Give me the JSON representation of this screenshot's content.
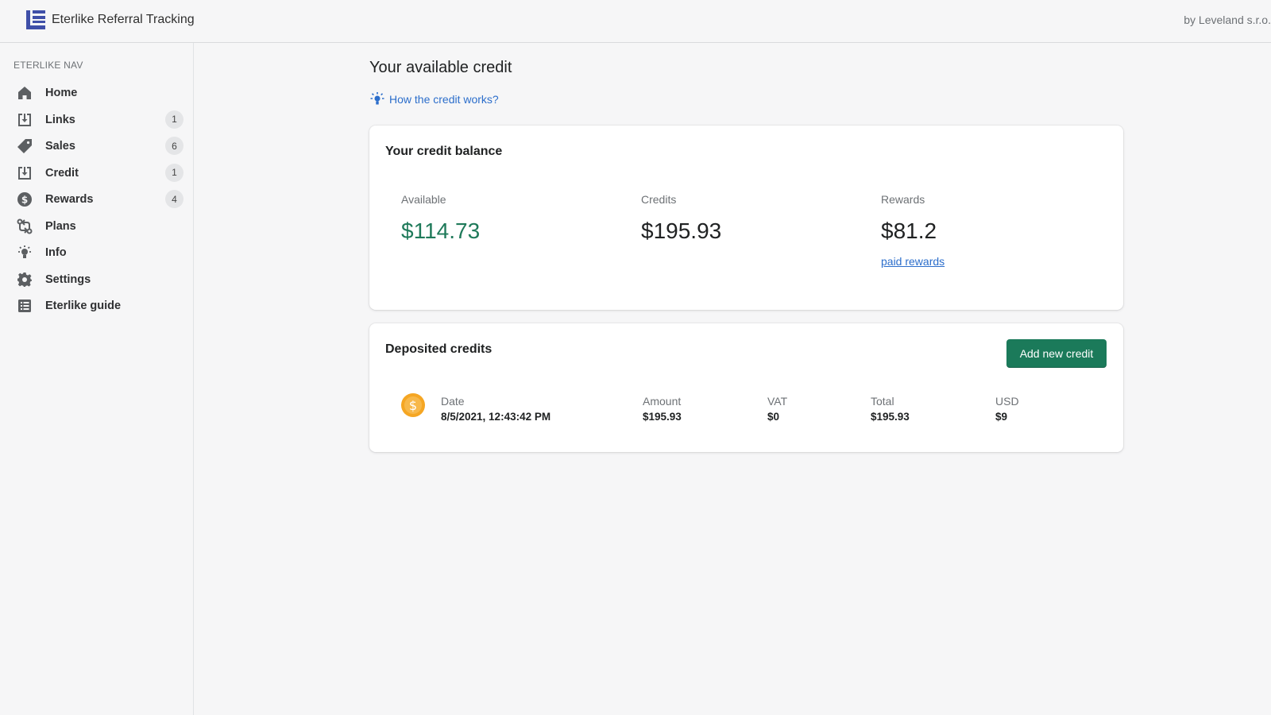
{
  "app": {
    "title": "Eterlike Referral Tracking",
    "vendor": "by Leveland s.r.o."
  },
  "sidebar": {
    "heading": "ETERLIKE NAV",
    "items": [
      {
        "label": "Home",
        "icon": "home-icon",
        "badge": ""
      },
      {
        "label": "Links",
        "icon": "inbox-download-icon",
        "badge": "1"
      },
      {
        "label": "Sales",
        "icon": "tag-icon",
        "badge": "6"
      },
      {
        "label": "Credit",
        "icon": "inbox-download-icon",
        "badge": "1"
      },
      {
        "label": "Rewards",
        "icon": "dollar-circle-icon",
        "badge": "4"
      },
      {
        "label": "Plans",
        "icon": "exchange-icon",
        "badge": ""
      },
      {
        "label": "Info",
        "icon": "lightbulb-icon",
        "badge": ""
      },
      {
        "label": "Settings",
        "icon": "gear-icon",
        "badge": ""
      },
      {
        "label": "Eterlike guide",
        "icon": "list-icon",
        "badge": ""
      }
    ]
  },
  "main": {
    "title": "Your available credit",
    "help_link": "How the credit works?",
    "balance": {
      "title": "Your credit balance",
      "available_label": "Available",
      "available_value": "$114.73",
      "credits_label": "Credits",
      "credits_value": "$195.93",
      "rewards_label": "Rewards",
      "rewards_value": "$81.2",
      "paid_rewards_link": "paid rewards"
    },
    "deposits": {
      "title": "Deposited credits",
      "add_button": "Add new credit",
      "rows": [
        {
          "date_label": "Date",
          "date": "8/5/2021, 12:43:42 PM",
          "amount_label": "Amount",
          "amount": "$195.93",
          "vat_label": "VAT",
          "vat": "$0",
          "total_label": "Total",
          "total": "$195.93",
          "usd_label": "USD",
          "usd": "$9"
        }
      ]
    }
  },
  "colors": {
    "accent_green": "#1f7a5a",
    "button_green": "#1b7a5a",
    "link_blue": "#2c6ecb",
    "logo_blue": "#3f4fa8",
    "coin_orange": "#f5a623"
  }
}
